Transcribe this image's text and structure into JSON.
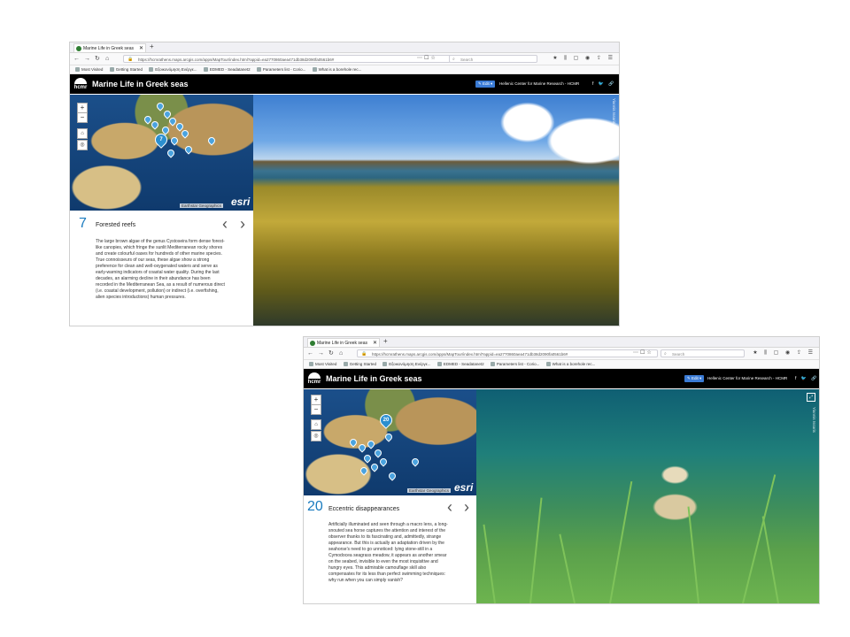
{
  "shots": [
    {
      "tab_title": "Marine Life in Greek seas",
      "url": "https://hcmrathens.maps.arcgis.com/apps/MapTour/index.html?appid=ea2770860aea471db38d2090fa0561b6#",
      "search_placeholder": "Search",
      "bookmarks": [
        "Most Visited",
        "Getting Started",
        "Εξοικονόμηση Ενέργε...",
        "EDMED - Seadatanet2",
        "Parameters list - Corio...",
        "What is a borehole rec..."
      ],
      "app_title": "Marine Life in Greek seas",
      "logo_text": "hcmr",
      "edit_label": "Edit",
      "org_name": "Hellenic Center for Marine Research - HCMR",
      "map_pin_label": "7",
      "map_pins_extra": [
        "11",
        "20",
        "11"
      ],
      "map_attribution": "Earthstar Geographics",
      "esri": "esri",
      "story_number": "7",
      "story_title": "Forested reefs",
      "story_body": "The large brown algae of the genus Cystoseira form dense forest-like canopies, which fringe the sunlit Mediterranean rocky shores and create colourful oases for hundreds of other marine species. True connoisseurs of our seas, these algae show a strong preference for clean and well-oxygenated waters and serve as early-warning indicators of coastal water quality. During the last decades, an alarming decline in their abundance has been recorded in the Mediterranean Sea, as a result of numerous direct (i.e. coastal development, pollution) or indirect (i.e. overfishing, alien species introductions) human pressures.",
      "photo_credit": "Yiannis Issaris"
    },
    {
      "tab_title": "Marine Life in Greek seas",
      "url": "https://hcmrathens.maps.arcgis.com/apps/MapTour/index.html?appid=ea2770860aea471db38d2090fa0561b6#",
      "search_placeholder": "Search",
      "bookmarks": [
        "Most Visited",
        "Getting Started",
        "Εξοικονόμηση Ενέργε...",
        "EDMED - Seadatanet2",
        "Parameters list - Corio...",
        "What is a borehole rec..."
      ],
      "app_title": "Marine Life in Greek seas",
      "logo_text": "hcmr",
      "edit_label": "Edit",
      "org_name": "Hellenic Center for Marine Research - HCMR",
      "map_pin_label": "20",
      "map_pins_extra": [
        "11"
      ],
      "map_attribution": "Earthstar Geographics",
      "esri": "esri",
      "story_number": "20",
      "story_title": "Eccentric disappearances",
      "story_body": "Artificially illuminated and seen through a macro lens, a long-snouted sea horse captures the attention and interest of the observer thanks to its fascinating and, admittedly, strange appearance. But this is actually an adaptation driven by the seahorse's need to go unnoticed: lying stone-still in a Cymodocea seagrass meadow, it appears as another smear on the seabed, invisible to even the most inquisitive and hungry eyes. This admirable camouflage skill also compensates for its less than perfect swimming techniques: why run when you can simply vanish?",
      "photo_credit": "Yiannis Issaris"
    }
  ],
  "colors": {
    "accent": "#1a7bbf",
    "header_bg": "#000000",
    "edit_bg": "#3a7bd5"
  },
  "icons": [
    "back-arrow-icon",
    "forward-arrow-icon",
    "reload-icon",
    "home-icon",
    "lock-icon",
    "search-icon",
    "zoom-in-icon",
    "zoom-out-icon",
    "home-extent-icon",
    "locate-icon",
    "prev-arrow-icon",
    "next-arrow-icon",
    "facebook-icon",
    "twitter-icon",
    "link-icon",
    "expand-icon"
  ]
}
